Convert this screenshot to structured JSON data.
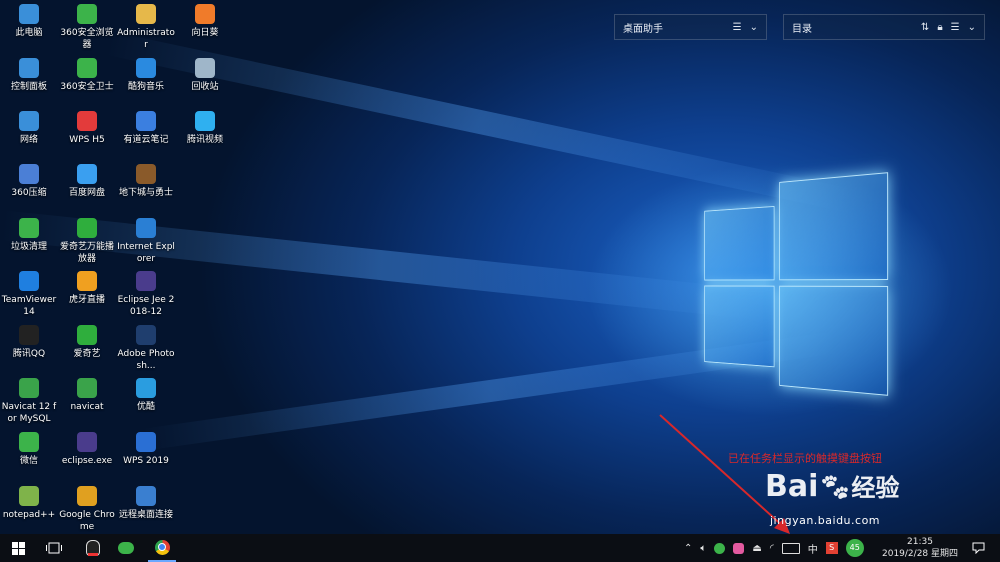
{
  "desktop_icons": [
    {
      "label": "此电脑",
      "icon": "computer-icon",
      "color": "#3a8fd9"
    },
    {
      "label": "360安全浏览器",
      "icon": "360-browser-icon",
      "color": "#3cb34a"
    },
    {
      "label": "Administrator",
      "icon": "user-folder-icon",
      "color": "#e6b84a"
    },
    {
      "label": "向日葵",
      "icon": "sunflower-icon",
      "color": "#f07b2a"
    },
    {
      "label": "控制面板",
      "icon": "control-panel-icon",
      "color": "#3a8fd9"
    },
    {
      "label": "360安全卫士",
      "icon": "360-security-icon",
      "color": "#3cb34a"
    },
    {
      "label": "酷狗音乐",
      "icon": "kugou-icon",
      "color": "#2a8ae0"
    },
    {
      "label": "回收站",
      "icon": "recycle-bin-icon",
      "color": "#9fb6c9"
    },
    {
      "label": "网络",
      "icon": "network-icon",
      "color": "#3a8fd9"
    },
    {
      "label": "WPS H5",
      "icon": "wps-h5-icon",
      "color": "#e33b3b"
    },
    {
      "label": "有道云笔记",
      "icon": "youdao-note-icon",
      "color": "#3b7fe0"
    },
    {
      "label": "腾讯视频",
      "icon": "tencent-video-icon",
      "color": "#2fb0f0"
    },
    {
      "label": "360压缩",
      "icon": "360-zip-icon",
      "color": "#4b7fd6"
    },
    {
      "label": "百度网盘",
      "icon": "baidu-pan-icon",
      "color": "#3a9ff0"
    },
    {
      "label": "地下城与勇士",
      "icon": "dnf-icon",
      "color": "#8a5a2a"
    },
    {
      "label": "垃圾清理",
      "icon": "cleaner-icon",
      "color": "#3cb34a"
    },
    {
      "label": "爱奇艺万能播放器",
      "icon": "iqiyi-player-icon",
      "color": "#2fae3d"
    },
    {
      "label": "Internet Explorer",
      "icon": "ie-icon",
      "color": "#2a7fd4"
    },
    {
      "label": "TeamViewer 14",
      "icon": "teamviewer-icon",
      "color": "#1f7fe0"
    },
    {
      "label": "虎牙直播",
      "icon": "huya-icon",
      "color": "#f0a020"
    },
    {
      "label": "Eclipse Jee 2018-12",
      "icon": "eclipse-icon",
      "color": "#4a3c8c"
    },
    {
      "label": "腾讯QQ",
      "icon": "qq-icon",
      "color": "#222222"
    },
    {
      "label": "爱奇艺",
      "icon": "iqiyi-icon",
      "color": "#2fae3d"
    },
    {
      "label": "Adobe Photosh...",
      "icon": "photoshop-icon",
      "color": "#1f3e6e"
    },
    {
      "label": "Navicat 12 for MySQL",
      "icon": "navicat-mysql-icon",
      "color": "#3aa34a"
    },
    {
      "label": "navicat",
      "icon": "navicat-icon",
      "color": "#3aa34a"
    },
    {
      "label": "优酷",
      "icon": "youku-icon",
      "color": "#2a9de0"
    },
    {
      "label": "微信",
      "icon": "wechat-icon",
      "color": "#3cb34a"
    },
    {
      "label": "eclipse.exe",
      "icon": "eclipse-exe-icon",
      "color": "#4a3c8c"
    },
    {
      "label": "WPS 2019",
      "icon": "wps-2019-icon",
      "color": "#2a6fd4"
    },
    {
      "label": "notepad++",
      "icon": "notepad-plus-icon",
      "color": "#7fb34a"
    },
    {
      "label": "Google Chrome",
      "icon": "chrome-icon",
      "color": "#e0a020"
    },
    {
      "label": "远程桌面连接",
      "icon": "remote-desktop-icon",
      "color": "#3a7fd0"
    }
  ],
  "widgets": {
    "assistant": {
      "title": "桌面助手"
    },
    "directory": {
      "title": "目录"
    }
  },
  "annotation": {
    "text": "已在任务栏显示的触摸键盘按钮"
  },
  "watermark": {
    "brand": "Bai",
    "brand2": "经验",
    "url": "jingyan.baidu.com"
  },
  "taskbar": {
    "pinned": [
      "start-icon",
      "task-view-icon",
      "qq-icon",
      "wechat-icon",
      "chrome-icon"
    ],
    "tray": {
      "ime_label": "中",
      "badge": "45",
      "time": "21:35",
      "date": "2019/2/28 星期四"
    }
  }
}
